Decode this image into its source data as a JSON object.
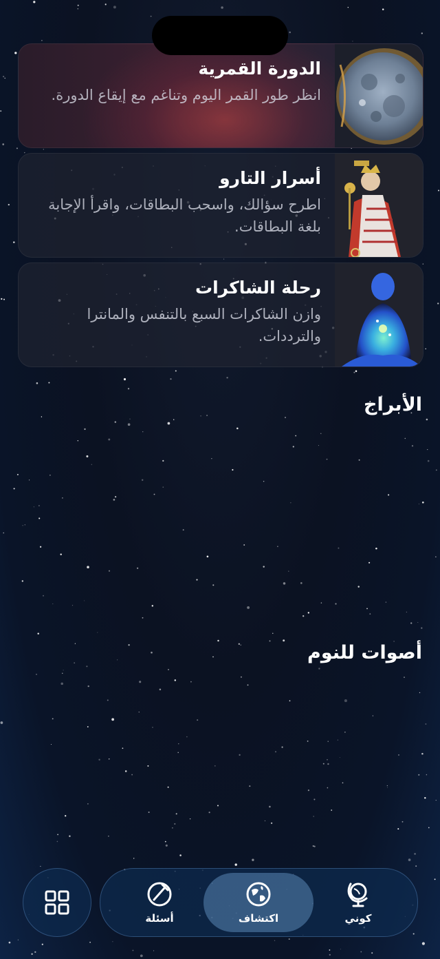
{
  "cards": [
    {
      "title": "الدورة القمرية",
      "description": "انظر طور القمر اليوم وتناغم مع إيقاع الدورة.",
      "icon": "moon-icon"
    },
    {
      "title": "أسرار التارو",
      "description": "اطرح سؤالك، واسحب البطاقات، واقرأ الإجابة بلغة البطاقات.",
      "icon": "tarot-card-icon"
    },
    {
      "title": "رحلة الشاكرات",
      "description": "وازن الشاكرات السبع بالتنفس والمانترا والترددات.",
      "icon": "chakra-figure-icon"
    }
  ],
  "sections": {
    "zodiac": "الأبراج",
    "sleep_sounds": "أصوات للنوم"
  },
  "nav": {
    "menu_icon": "grid-icon",
    "tabs": [
      {
        "label": "أسئلة",
        "icon": "compass-pen-icon"
      },
      {
        "label": "اكتشاف",
        "icon": "globe-icon",
        "active": true
      },
      {
        "label": "كوني",
        "icon": "desk-globe-icon"
      }
    ]
  },
  "colors": {
    "background": "#0b1222",
    "nav_background": "#0e2a4e",
    "active_tab": "#5a87b4"
  }
}
